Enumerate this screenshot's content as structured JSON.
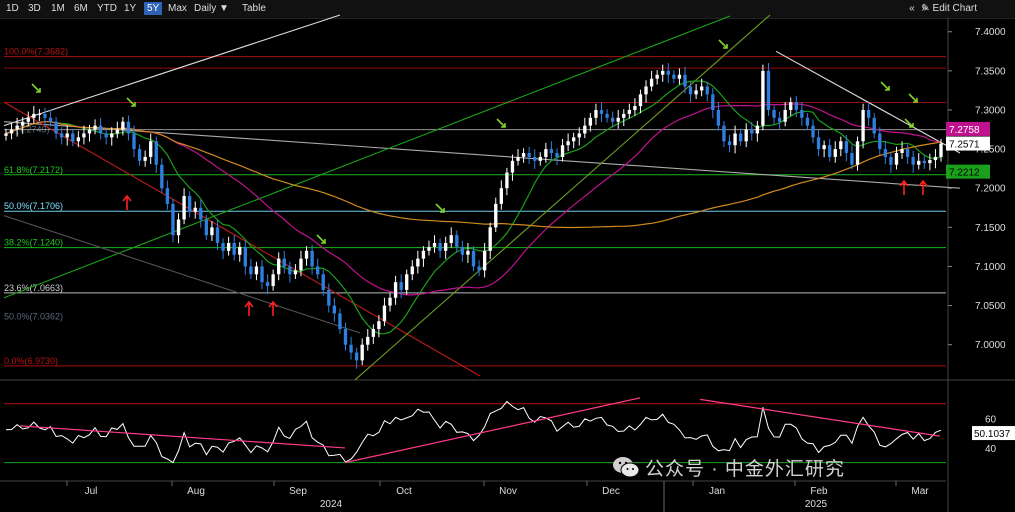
{
  "toolbar": {
    "ranges": [
      "1D",
      "3D",
      "1M",
      "6M",
      "YTD",
      "1Y",
      "5Y",
      "Max"
    ],
    "active_range": "5Y",
    "interval": "Daily",
    "table_label": "Table",
    "edit_chart": "Edit Chart",
    "nav": "« »"
  },
  "colors": {
    "up_candle": "#ffffff",
    "down_candle": "#2f7fe0",
    "green_ma": "#1aa01a",
    "magenta_ma": "#c0128f",
    "orange_ma": "#d08a1e",
    "fib_red": "#b81212",
    "fib_green": "#1ec81e",
    "fib_cyan": "#7fe0ff",
    "rsi_line": "#ffffff",
    "trendline_pink": "#ff3b8a"
  },
  "fib_labels": [
    {
      "text": "100.0%(7.3682)",
      "value": 7.3682,
      "color": "#b81212"
    },
    {
      "text": "61.8%(7.2172)",
      "value": 7.2172,
      "color": "#1ec81e"
    },
    {
      "text": "50.0%(7.1706)",
      "value": 7.1706,
      "color": "#7fe0ff"
    },
    {
      "text": "38.2%(7.1240)",
      "value": 7.124,
      "color": "#1ec81e"
    },
    {
      "text": "23.6%(7.0663)",
      "value": 7.0663,
      "color": "#d0d0d0"
    },
    {
      "text": "0.0%(6.9730)",
      "value": 6.973,
      "color": "#b81212"
    }
  ],
  "faded_labels": [
    {
      "text": "(7.2749)",
      "value": 7.2749
    },
    {
      "text": "50.0%(7.0362)",
      "value": 7.0362
    }
  ],
  "price_badges": [
    {
      "text": "7.2758",
      "value": 7.2758,
      "bg": "#c0128f",
      "fg": "#ffffff"
    },
    {
      "text": "7.2571",
      "value": 7.2571,
      "bg": "#ffffff",
      "fg": "#000000"
    },
    {
      "text": "7.2212",
      "value": 7.2212,
      "bg": "#1aa01a",
      "fg": "#000000"
    }
  ],
  "rsi_badge": {
    "text": "50.1037",
    "value": 50.1037
  },
  "rsi_ticks": [
    "60",
    "40"
  ],
  "watermark": "公众号 · 中金外汇研究",
  "chart_data": {
    "type": "candlestick",
    "ylim": [
      6.96,
      7.415
    ],
    "yticks": [
      "7.4000",
      "7.3500",
      "7.3000",
      "7.2500",
      "7.2000",
      "7.1500",
      "7.1000",
      "7.0500",
      "7.0000"
    ],
    "ytick_values": [
      7.4,
      7.35,
      7.3,
      7.25,
      7.2,
      7.15,
      7.1,
      7.05,
      7.0
    ],
    "x_months": [
      "Jul",
      "Aug",
      "Sep",
      "Oct",
      "Nov",
      "Dec",
      "Jan",
      "Feb",
      "Mar"
    ],
    "x_years": [
      "2024",
      "2025"
    ],
    "close": [
      7.27,
      7.275,
      7.28,
      7.285,
      7.29,
      7.295,
      7.295,
      7.29,
      7.285,
      7.27,
      7.265,
      7.27,
      7.26,
      7.265,
      7.27,
      7.275,
      7.28,
      7.27,
      7.265,
      7.27,
      7.275,
      7.285,
      7.27,
      7.25,
      7.235,
      7.24,
      7.26,
      7.23,
      7.2,
      7.18,
      7.14,
      7.16,
      7.19,
      7.17,
      7.175,
      7.16,
      7.14,
      7.15,
      7.13,
      7.12,
      7.13,
      7.115,
      7.125,
      7.1,
      7.09,
      7.1,
      7.08,
      7.075,
      7.09,
      7.11,
      7.1,
      7.09,
      7.095,
      7.11,
      7.12,
      7.1,
      7.09,
      7.07,
      7.05,
      7.04,
      7.02,
      7.0,
      6.99,
      6.98,
      7.0,
      7.01,
      7.02,
      7.03,
      7.05,
      7.06,
      7.08,
      7.07,
      7.09,
      7.1,
      7.11,
      7.12,
      7.125,
      7.13,
      7.12,
      7.13,
      7.14,
      7.125,
      7.115,
      7.12,
      7.1,
      7.095,
      7.12,
      7.15,
      7.18,
      7.2,
      7.22,
      7.235,
      7.24,
      7.245,
      7.24,
      7.235,
      7.24,
      7.25,
      7.245,
      7.24,
      7.255,
      7.26,
      7.265,
      7.27,
      7.28,
      7.29,
      7.3,
      7.295,
      7.29,
      7.285,
      7.29,
      7.295,
      7.3,
      7.305,
      7.32,
      7.33,
      7.34,
      7.345,
      7.35,
      7.345,
      7.34,
      7.345,
      7.33,
      7.32,
      7.325,
      7.33,
      7.32,
      7.3,
      7.28,
      7.26,
      7.255,
      7.27,
      7.26,
      7.275,
      7.27,
      7.28,
      7.35,
      7.3,
      7.29,
      7.285,
      7.3,
      7.31,
      7.3,
      7.29,
      7.28,
      7.265,
      7.25,
      7.255,
      7.24,
      7.25,
      7.26,
      7.245,
      7.23,
      7.26,
      7.3,
      7.29,
      7.27,
      7.25,
      7.24,
      7.23,
      7.245,
      7.25,
      7.24,
      7.23,
      7.235,
      7.232,
      7.236,
      7.24,
      7.2571
    ]
  }
}
